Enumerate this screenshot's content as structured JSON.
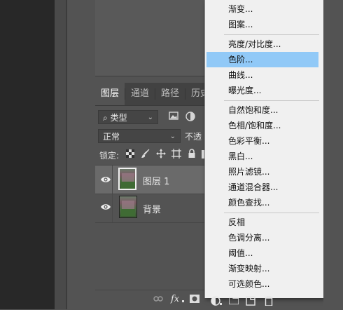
{
  "layers_panel": {
    "tabs": [
      "图层",
      "通道",
      "路径",
      "历史"
    ],
    "filter": {
      "label": "类型",
      "search_glyph": "⌕"
    },
    "blend_mode": "正常",
    "opacity_label": "不透",
    "lock_label": "锁定:",
    "layers": [
      {
        "name": "图层 1",
        "visible": true,
        "selected": true
      },
      {
        "name": "背景",
        "visible": true,
        "selected": false
      }
    ],
    "bottom_icons": [
      "link-icon",
      "fx-icon",
      "mask-icon",
      "adjustment-icon",
      "folder-icon",
      "new-layer-icon",
      "trash-icon"
    ],
    "fx_label": "fx"
  },
  "adjustment_menu": {
    "items": [
      "渐变...",
      "图案...",
      "亮度/对比度...",
      "色阶...",
      "曲线...",
      "曝光度...",
      "自然饱和度...",
      "色相/饱和度...",
      "色彩平衡...",
      "黑白...",
      "照片滤镜...",
      "通道混合器...",
      "颜色查找...",
      "反相",
      "色调分离...",
      "阈值...",
      "渐变映射...",
      "可选颜色..."
    ],
    "highlighted": "色阶...",
    "highlight_color": "#91c9f7"
  }
}
